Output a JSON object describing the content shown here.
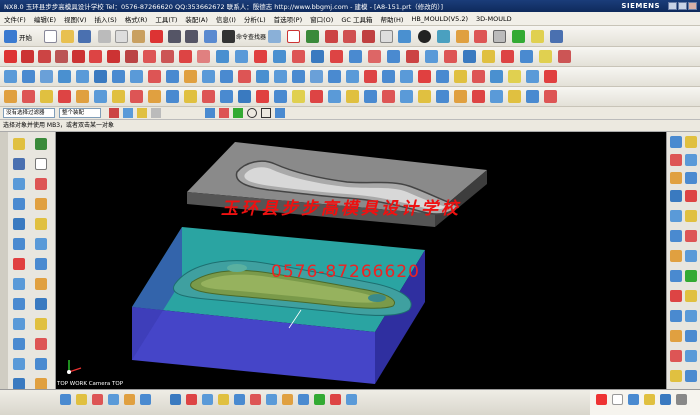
{
  "window": {
    "title": "NX8.0  玉环县步步高模具设计学校   Tel：0576-87266620 QQ:353662672  联系人：殷德志  http://www.bbgmj.com - 建模 - [A8-151.prt（修改的）]",
    "brand": "SIEMENS"
  },
  "menu": {
    "items": [
      "文件(F)",
      "编辑(E)",
      "视图(V)",
      "插入(S)",
      "格式(R)",
      "工具(T)",
      "装配(A)",
      "信息(I)",
      "分析(L)",
      "首选项(P)",
      "窗口(O)",
      "GC 工具箱",
      "帮助(H)",
      "HB_MOULD(V5.2)",
      "3D-MOULD"
    ]
  },
  "toolbar": {
    "start_label": "开始",
    "command_finder_label": "命令查找器"
  },
  "selection": {
    "filter": "没有选择过滤器",
    "scope": "整个装配"
  },
  "cue_line": "选择对象并使用 MB3，或者双击某一对象",
  "viewport": {
    "watermark_school": "玉环县步步高模具设计学校",
    "watermark_phone": "0576-87266620",
    "view_label": "TOP WORK Camera TOP"
  },
  "colors": {
    "background": "#000000",
    "cavity_plate": "#6b6b6b",
    "core_cyan": "#2fb6b4",
    "core_blue": "#4545c8",
    "part_green": "#7a9a4a",
    "watermark": "#e11111"
  }
}
